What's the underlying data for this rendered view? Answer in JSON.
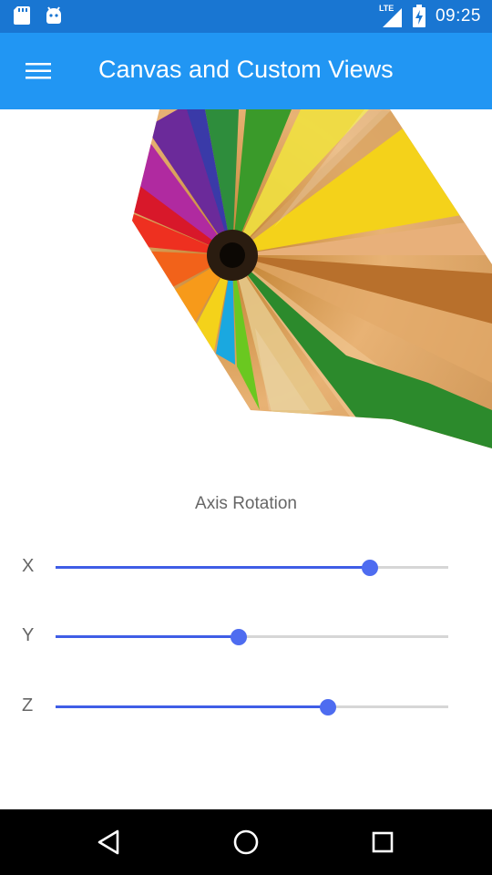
{
  "status_bar": {
    "left_icons": [
      "sd-card-icon",
      "android-icon"
    ],
    "network": "LTE",
    "time": "09:25"
  },
  "app_bar": {
    "title": "Canvas and Custom Views",
    "menu_icon": "hamburger-menu-icon"
  },
  "canvas": {
    "image": "colored-pencils-photo",
    "description": "Rotated colored pencils image"
  },
  "controls": {
    "title": "Axis Rotation",
    "sliders": [
      {
        "label": "X",
        "value": 0.8
      },
      {
        "label": "Y",
        "value": 0.467
      },
      {
        "label": "Z",
        "value": 0.694
      }
    ]
  },
  "nav_bar": {
    "buttons": [
      "back-icon",
      "home-icon",
      "recents-icon"
    ]
  },
  "colors": {
    "status_bar": "#1976d2",
    "app_bar": "#2196f3",
    "slider_accent": "#4e6cf0"
  }
}
